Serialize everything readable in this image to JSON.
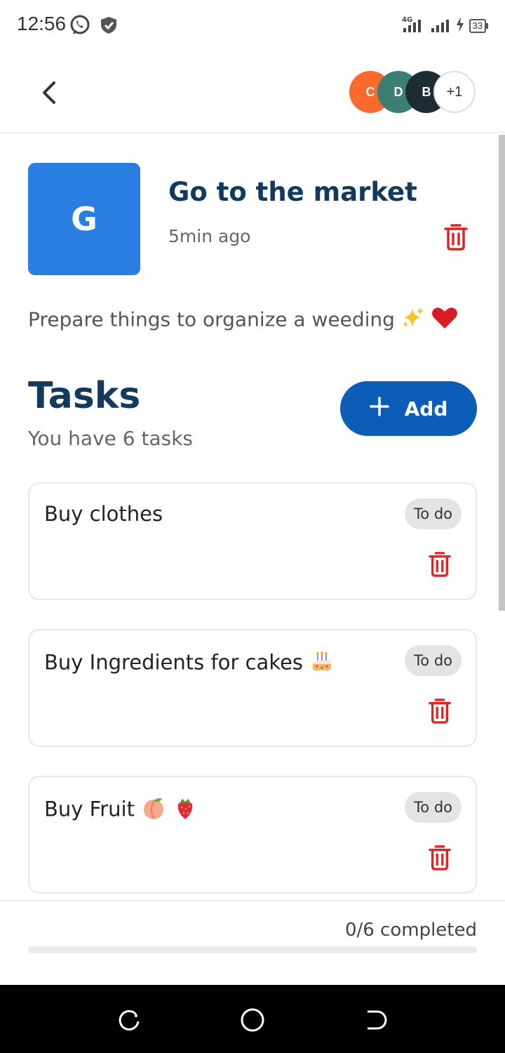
{
  "status_bar": {
    "time": "12:56",
    "network": "4G",
    "battery": "33"
  },
  "app_bar": {
    "members": [
      {
        "initial": "C",
        "color": "#f96a2c"
      },
      {
        "initial": "D",
        "color": "#3b7f74"
      },
      {
        "initial": "B",
        "color": "#1d2b33"
      }
    ],
    "more_members": "+1"
  },
  "project": {
    "avatar_letter": "G",
    "title": "Go to the market",
    "time_ago": "5min ago",
    "description": "Prepare things to organize a weeding"
  },
  "tasks_section": {
    "title": "Tasks",
    "subtitle": "You have 6 tasks",
    "add_label": "Add"
  },
  "tasks": [
    {
      "name": "Buy clothes",
      "status": "To do"
    },
    {
      "name": "Buy Ingredients for cakes",
      "status": "To do"
    },
    {
      "name": "Buy Fruit",
      "status": "To do"
    }
  ],
  "progress": {
    "label": "0/6 completed",
    "fraction": 0
  },
  "colors": {
    "accent": "#0b5db8",
    "title": "#113a5d",
    "danger": "#e02424",
    "project_avatar": "#2a7de1"
  }
}
